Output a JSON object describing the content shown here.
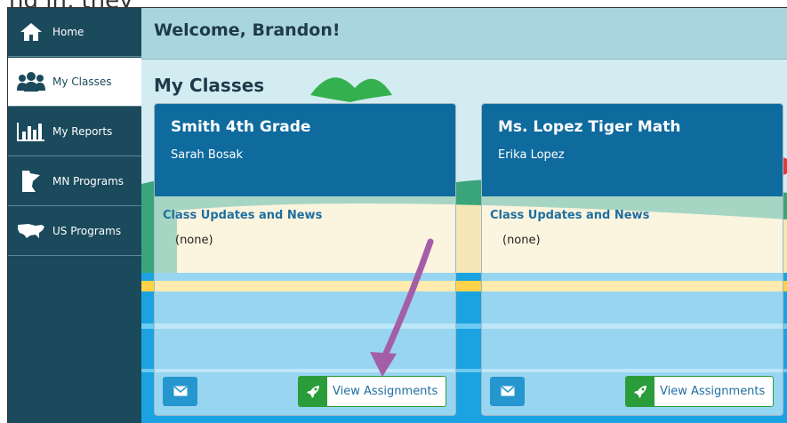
{
  "caption_fragment": "ng in, they",
  "sidebar": {
    "items": [
      {
        "label": "Home",
        "icon": "home-icon"
      },
      {
        "label": "My Classes",
        "icon": "users-icon",
        "active": true
      },
      {
        "label": "My Reports",
        "icon": "bar-chart-icon"
      },
      {
        "label": "MN Programs",
        "icon": "minnesota-map-icon"
      },
      {
        "label": "US Programs",
        "icon": "usa-map-icon"
      }
    ]
  },
  "header": {
    "welcome": "Welcome, Brandon!"
  },
  "main": {
    "section_title": "My Classes",
    "classes": [
      {
        "title": "Smith 4th Grade",
        "teacher": "Sarah Bosak",
        "updates_title": "Class Updates and News",
        "updates_value": "(none)",
        "view_label": "View Assignments"
      },
      {
        "title": "Ms. Lopez Tiger Math",
        "teacher": "Erika Lopez",
        "updates_title": "Class Updates and News",
        "updates_value": "(none)",
        "view_label": "View Assignments"
      }
    ]
  },
  "colors": {
    "sidebar": "#1a4a5c",
    "card_header": "#0f6b9e",
    "accent_green": "#2a9d3a",
    "mail_blue": "#2696cf",
    "annotation_arrow": "#a45ea8"
  }
}
